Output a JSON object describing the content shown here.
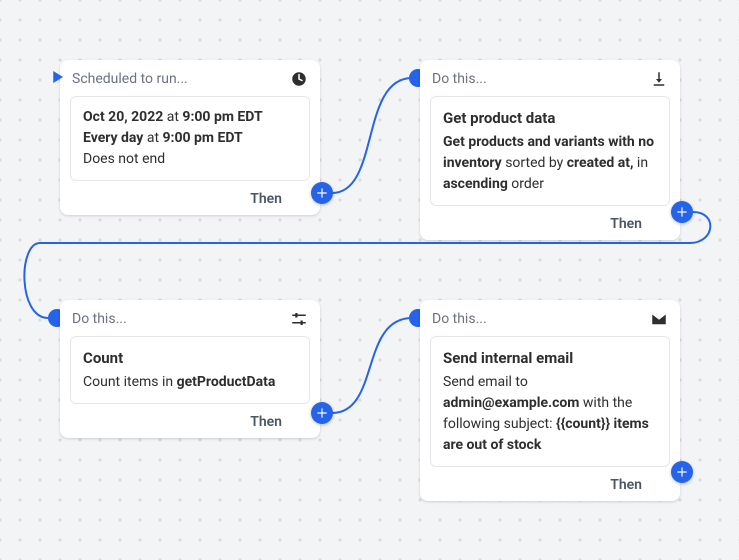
{
  "cards": {
    "trigger": {
      "header_label": "Scheduled to run...",
      "date": "Oct 20, 2022",
      "at1": " at ",
      "time1": "9:00 pm EDT",
      "freq": "Every day",
      "at2": " at ",
      "time2": "9:00 pm EDT",
      "ends": "Does not end"
    },
    "getProducts": {
      "header_label": "Do this...",
      "title": "Get product data",
      "d1": "Get products and variants with no inventory",
      "d2": " sorted by ",
      "d3": "created at,",
      "d4": " in ",
      "d5": "ascending",
      "d6": " order"
    },
    "count": {
      "header_label": "Do this...",
      "title": "Count",
      "d1": "Count items in ",
      "d2": "getProductData"
    },
    "email": {
      "header_label": "Do this...",
      "title": "Send internal email",
      "d1": "Send email to ",
      "d2": "admin@example.com",
      "d3": " with the following subject: ",
      "d4": "{{count}} items are out of stock"
    }
  },
  "then_label": "Then"
}
